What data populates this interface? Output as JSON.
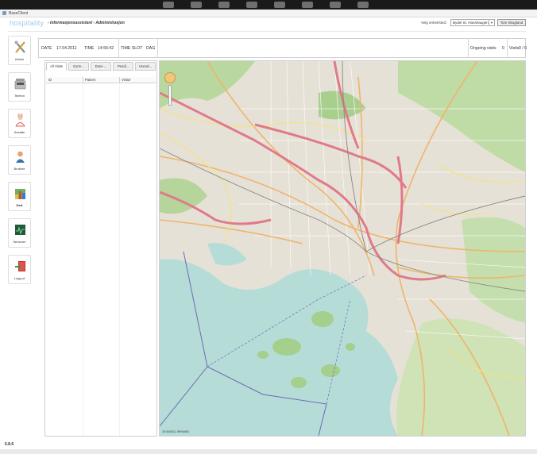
{
  "window": {
    "title": "BaseClient"
  },
  "header": {
    "brand": "hospitality",
    "subtitle": "- Informasjonsassistent - Administrasjon",
    "location_label": "Velg enhet/sted:",
    "location_value": "Bydel St. Hanshaugen",
    "user": "Tom Skoglund"
  },
  "sidebar": {
    "items": [
      {
        "label": "Admin",
        "icon": "tools-icon"
      },
      {
        "label": "Telefon",
        "icon": "phone-icon"
      },
      {
        "label": "Ansatte",
        "icon": "nurse-icon"
      },
      {
        "label": "Brukere",
        "icon": "person-icon"
      },
      {
        "label": "Kart",
        "icon": "map-icon"
      },
      {
        "label": "Sensorer",
        "icon": "sensor-icon"
      },
      {
        "label": "Logg ut",
        "icon": "logout-icon"
      }
    ]
  },
  "infobar": {
    "date_label": "DATE",
    "date_value": "17.04.2011",
    "time_label": "TIME",
    "time_value": "14:56:42",
    "slot_label": "TIME SLOT",
    "slot_value": "DAG",
    "ongoing_label": "Ongoing visits",
    "ongoing_value": "0",
    "visits_label": "Visits",
    "visits_value": "0 / 0"
  },
  "visits_panel": {
    "tabs": [
      "All Visits",
      "Curre...",
      "Done ...",
      "Pendi...",
      "Unend..."
    ],
    "columns": [
      "ID",
      "Patient",
      "Visitor"
    ]
  },
  "map": {
    "coordinates": "10.64332, 5994401"
  },
  "footer": {
    "version": "0.8.6"
  }
}
